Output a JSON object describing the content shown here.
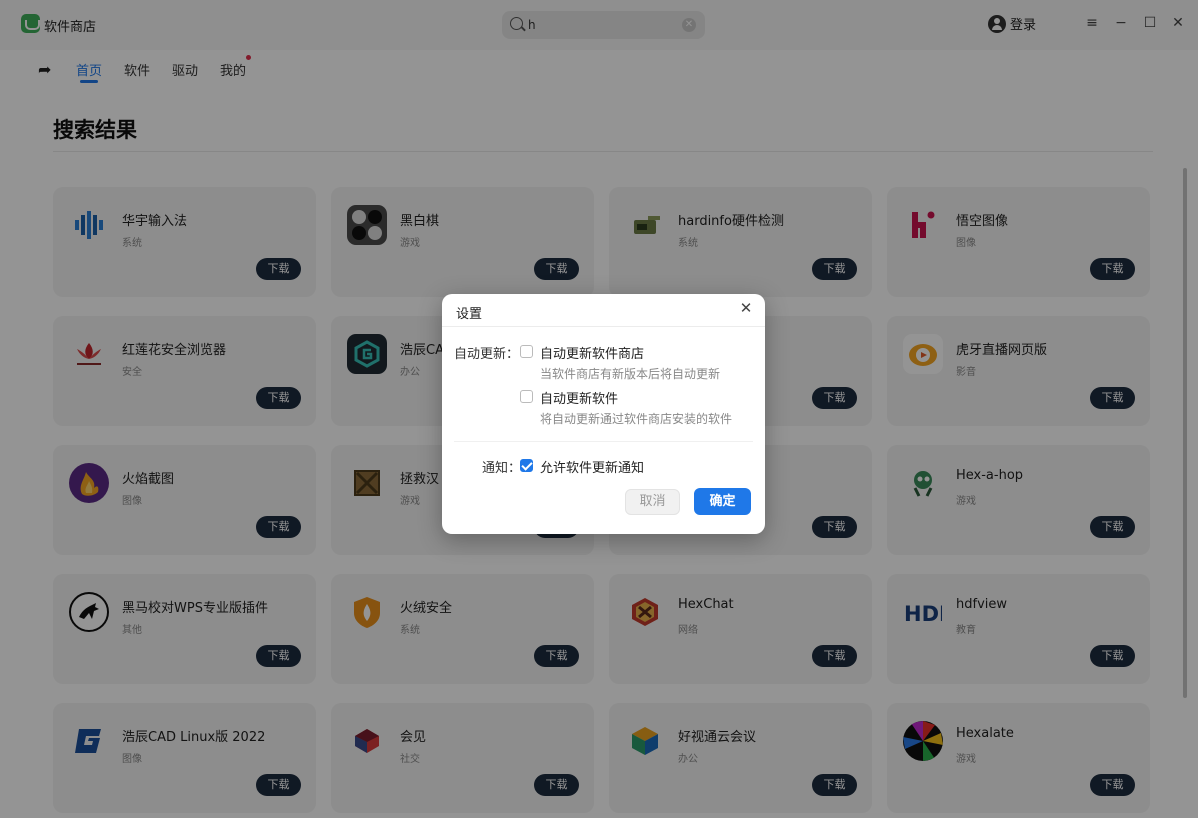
{
  "app": {
    "title": "软件商店"
  },
  "search": {
    "value": "h",
    "placeholder": ""
  },
  "account": {
    "login_label": "登录"
  },
  "nav": {
    "tabs": [
      {
        "label": "首页",
        "active": true
      },
      {
        "label": "软件",
        "active": false
      },
      {
        "label": "驱动",
        "active": false
      },
      {
        "label": "我的",
        "active": false,
        "badge_dot": true
      }
    ]
  },
  "page": {
    "title": "搜索结果"
  },
  "download_label": "下载",
  "apps": [
    {
      "name": "华宇输入法",
      "category": "系统",
      "icon": "huayu-input-icon"
    },
    {
      "name": "黑白棋",
      "category": "游戏",
      "icon": "reversi-icon"
    },
    {
      "name": "hardinfo硬件检测",
      "category": "系统",
      "icon": "hardinfo-icon"
    },
    {
      "name": "悟空图像",
      "category": "图像",
      "icon": "wukong-image-icon"
    },
    {
      "name": "红莲花安全浏览器",
      "category": "安全",
      "icon": "redlotus-browser-icon"
    },
    {
      "name": "浩辰CA",
      "category": "办公",
      "icon": "gstarcad-icon"
    },
    {
      "name": "",
      "category": "",
      "icon": "hidden-app-icon"
    },
    {
      "name": "虎牙直播网页版",
      "category": "影音",
      "icon": "huya-icon"
    },
    {
      "name": "火焰截图",
      "category": "图像",
      "icon": "flameshot-icon"
    },
    {
      "name": "拯救汉",
      "category": "游戏",
      "icon": "rescue-game-icon"
    },
    {
      "name": "",
      "category": "",
      "icon": "hidden-app-icon"
    },
    {
      "name": "Hex-a-hop",
      "category": "游戏",
      "icon": "hexahop-icon"
    },
    {
      "name": "黑马校对WPS专业版插件",
      "category": "其他",
      "icon": "heima-proofread-icon"
    },
    {
      "name": "火绒安全",
      "category": "系统",
      "icon": "huorong-icon"
    },
    {
      "name": "HexChat",
      "category": "网络",
      "icon": "hexchat-icon"
    },
    {
      "name": "hdfview",
      "category": "教育",
      "icon": "hdfview-icon"
    },
    {
      "name": "浩辰CAD Linux版 2022",
      "category": "图像",
      "icon": "gstarcad-linux-icon"
    },
    {
      "name": "会见",
      "category": "社交",
      "icon": "huijian-icon"
    },
    {
      "name": "好视通云会议",
      "category": "办公",
      "icon": "fsmeeting-icon"
    },
    {
      "name": "Hexalate",
      "category": "游戏",
      "icon": "hexalate-icon"
    }
  ],
  "dialog": {
    "title": "设置",
    "auto_update_label": "自动更新：",
    "opt_store_label": "自动更新软件商店",
    "opt_store_checked": false,
    "opt_store_hint": "当软件商店有新版本后将自动更新",
    "opt_apps_label": "自动更新软件",
    "opt_apps_checked": false,
    "opt_apps_hint": "将自动更新通过软件商店安装的软件",
    "notify_label": "通知：",
    "opt_notify_label": "允许软件更新通知",
    "opt_notify_checked": true,
    "cancel_label": "取消",
    "ok_label": "确定"
  },
  "colors": {
    "accent": "#1f78e8",
    "download_button": "#1d2b3e",
    "card_background": "#f3f3f3",
    "badge_dot": "#e0304c"
  }
}
